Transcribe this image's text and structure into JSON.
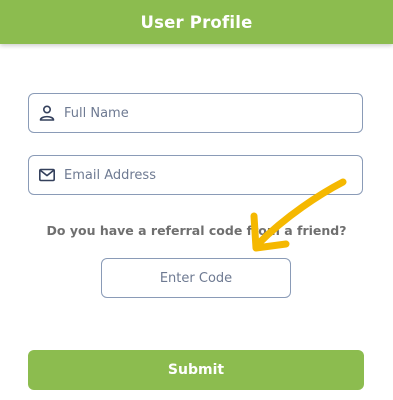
{
  "header": {
    "title": "User Profile"
  },
  "form": {
    "full_name": {
      "placeholder": "Full Name",
      "value": "",
      "icon": "person-icon"
    },
    "email": {
      "placeholder": "Email Address",
      "value": "",
      "icon": "envelope-icon"
    },
    "referral_question": "Do you have a referral code from a friend?",
    "referral_code": {
      "placeholder": "Enter Code",
      "value": ""
    },
    "submit_label": "Submit"
  },
  "annotation": {
    "icon": "arrow-annotation-icon",
    "color": "#f5b800"
  },
  "colors": {
    "brand": "#8cbc4f",
    "field_border": "#8a9bb7",
    "annotation": "#f5b800"
  }
}
